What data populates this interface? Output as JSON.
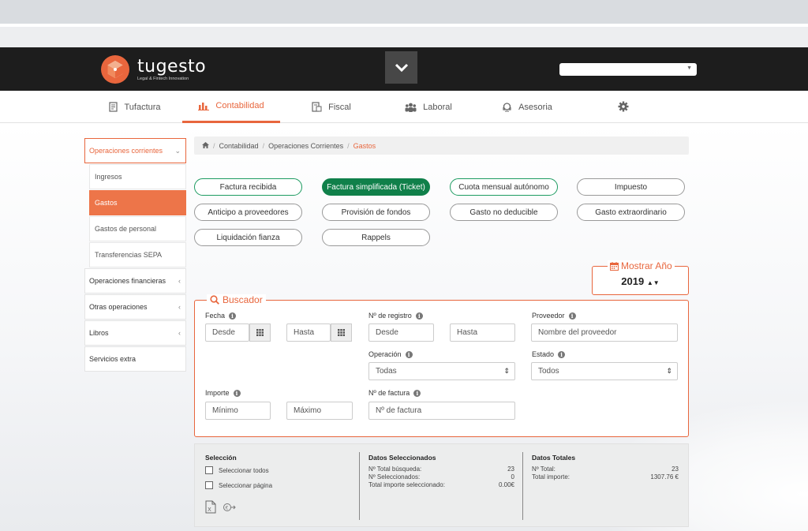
{
  "brand": {
    "name": "tugesto",
    "tagline": "Legal & Fintech Innovation",
    "accent": "#e8663d",
    "green": "#10804a"
  },
  "main_nav": [
    {
      "label": "Tufactura",
      "icon": "invoice-icon"
    },
    {
      "label": "Contabilidad",
      "icon": "bar-chart-icon",
      "active": true
    },
    {
      "label": "Fiscal",
      "icon": "document-icon"
    },
    {
      "label": "Laboral",
      "icon": "people-icon"
    },
    {
      "label": "Asesoria",
      "icon": "support-icon"
    },
    {
      "label": "",
      "icon": "gear-icon"
    }
  ],
  "sidebar": {
    "groups": [
      {
        "label": "Operaciones corrientes",
        "open": true,
        "children": [
          "Ingresos",
          "Gastos",
          "Gastos de personal",
          "Transferencias SEPA"
        ],
        "active_child": "Gastos"
      },
      {
        "label": "Operaciones financieras"
      },
      {
        "label": "Otras operaciones"
      },
      {
        "label": "Libros"
      },
      {
        "label": "Servicios extra"
      }
    ]
  },
  "breadcrumb": [
    "Contabilidad",
    "Operaciones Corrientes",
    "Gastos"
  ],
  "pills": [
    "Factura recibida",
    "Factura simplificada (Ticket)",
    "Cuota mensual autónomo",
    "Impuesto",
    "Anticipo a proveedores",
    "Provisión de fondos",
    "Gasto no deducible",
    "Gasto extraordinario",
    "Liquidación fianza",
    "Rappels"
  ],
  "year": {
    "legend": "Mostrar Año",
    "value": "2019"
  },
  "search": {
    "legend": "Buscador",
    "fecha_label": "Fecha",
    "desde_ph": "Desde",
    "hasta_ph": "Hasta",
    "registro_label": "Nº de registro",
    "reg_desde_ph": "Desde",
    "reg_hasta_ph": "Hasta",
    "proveedor_label": "Proveedor",
    "proveedor_ph": "Nombre del proveedor",
    "operacion_label": "Operación",
    "operacion_value": "Todas",
    "estado_label": "Estado",
    "estado_value": "Todos",
    "importe_label": "Importe",
    "min_ph": "Mínimo",
    "max_ph": "Máximo",
    "factura_label": "Nº de factura",
    "factura_ph": "Nº de factura"
  },
  "summary": {
    "seleccion_title": "Selección",
    "select_all": "Seleccionar todos",
    "select_page": "Seleccionar página",
    "datos_sel_title": "Datos Seleccionados",
    "total_busqueda_label": "Nº Total búsqueda:",
    "total_busqueda_value": "23",
    "seleccionados_label": "Nº Seleccionados:",
    "seleccionados_value": "0",
    "importe_sel_label": "Total importe seleccionado:",
    "importe_sel_value": "0.00€",
    "datos_tot_title": "Datos Totales",
    "total_label": "Nº Total:",
    "total_value": "23",
    "total_importe_label": "Total importe:",
    "total_importe_value": "1307.76 €"
  }
}
